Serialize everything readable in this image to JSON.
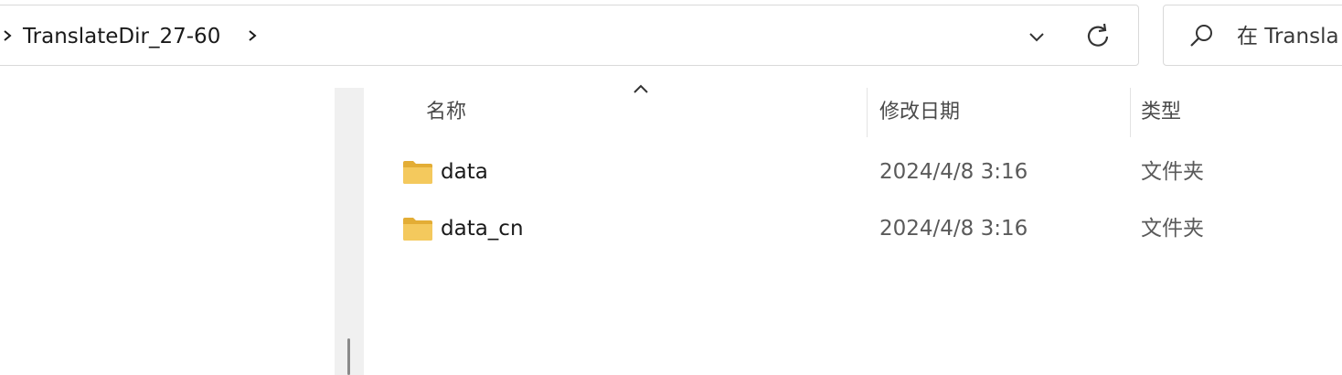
{
  "address_bar": {
    "breadcrumb_folder": "TranslateDir_27-60"
  },
  "search": {
    "placeholder": "在 Transla"
  },
  "columns": {
    "name": "名称",
    "date_modified": "修改日期",
    "type": "类型"
  },
  "files": [
    {
      "name": "data",
      "date": "2024/4/8 3:16",
      "type": "文件夹",
      "icon": "folder-icon"
    },
    {
      "name": "data_cn",
      "date": "2024/4/8 3:16",
      "type": "文件夹",
      "icon": "folder-icon"
    }
  ],
  "colors": {
    "folder_yellow": "#f4c95d",
    "folder_dark": "#e3ad35",
    "border": "#d9d9d9"
  }
}
